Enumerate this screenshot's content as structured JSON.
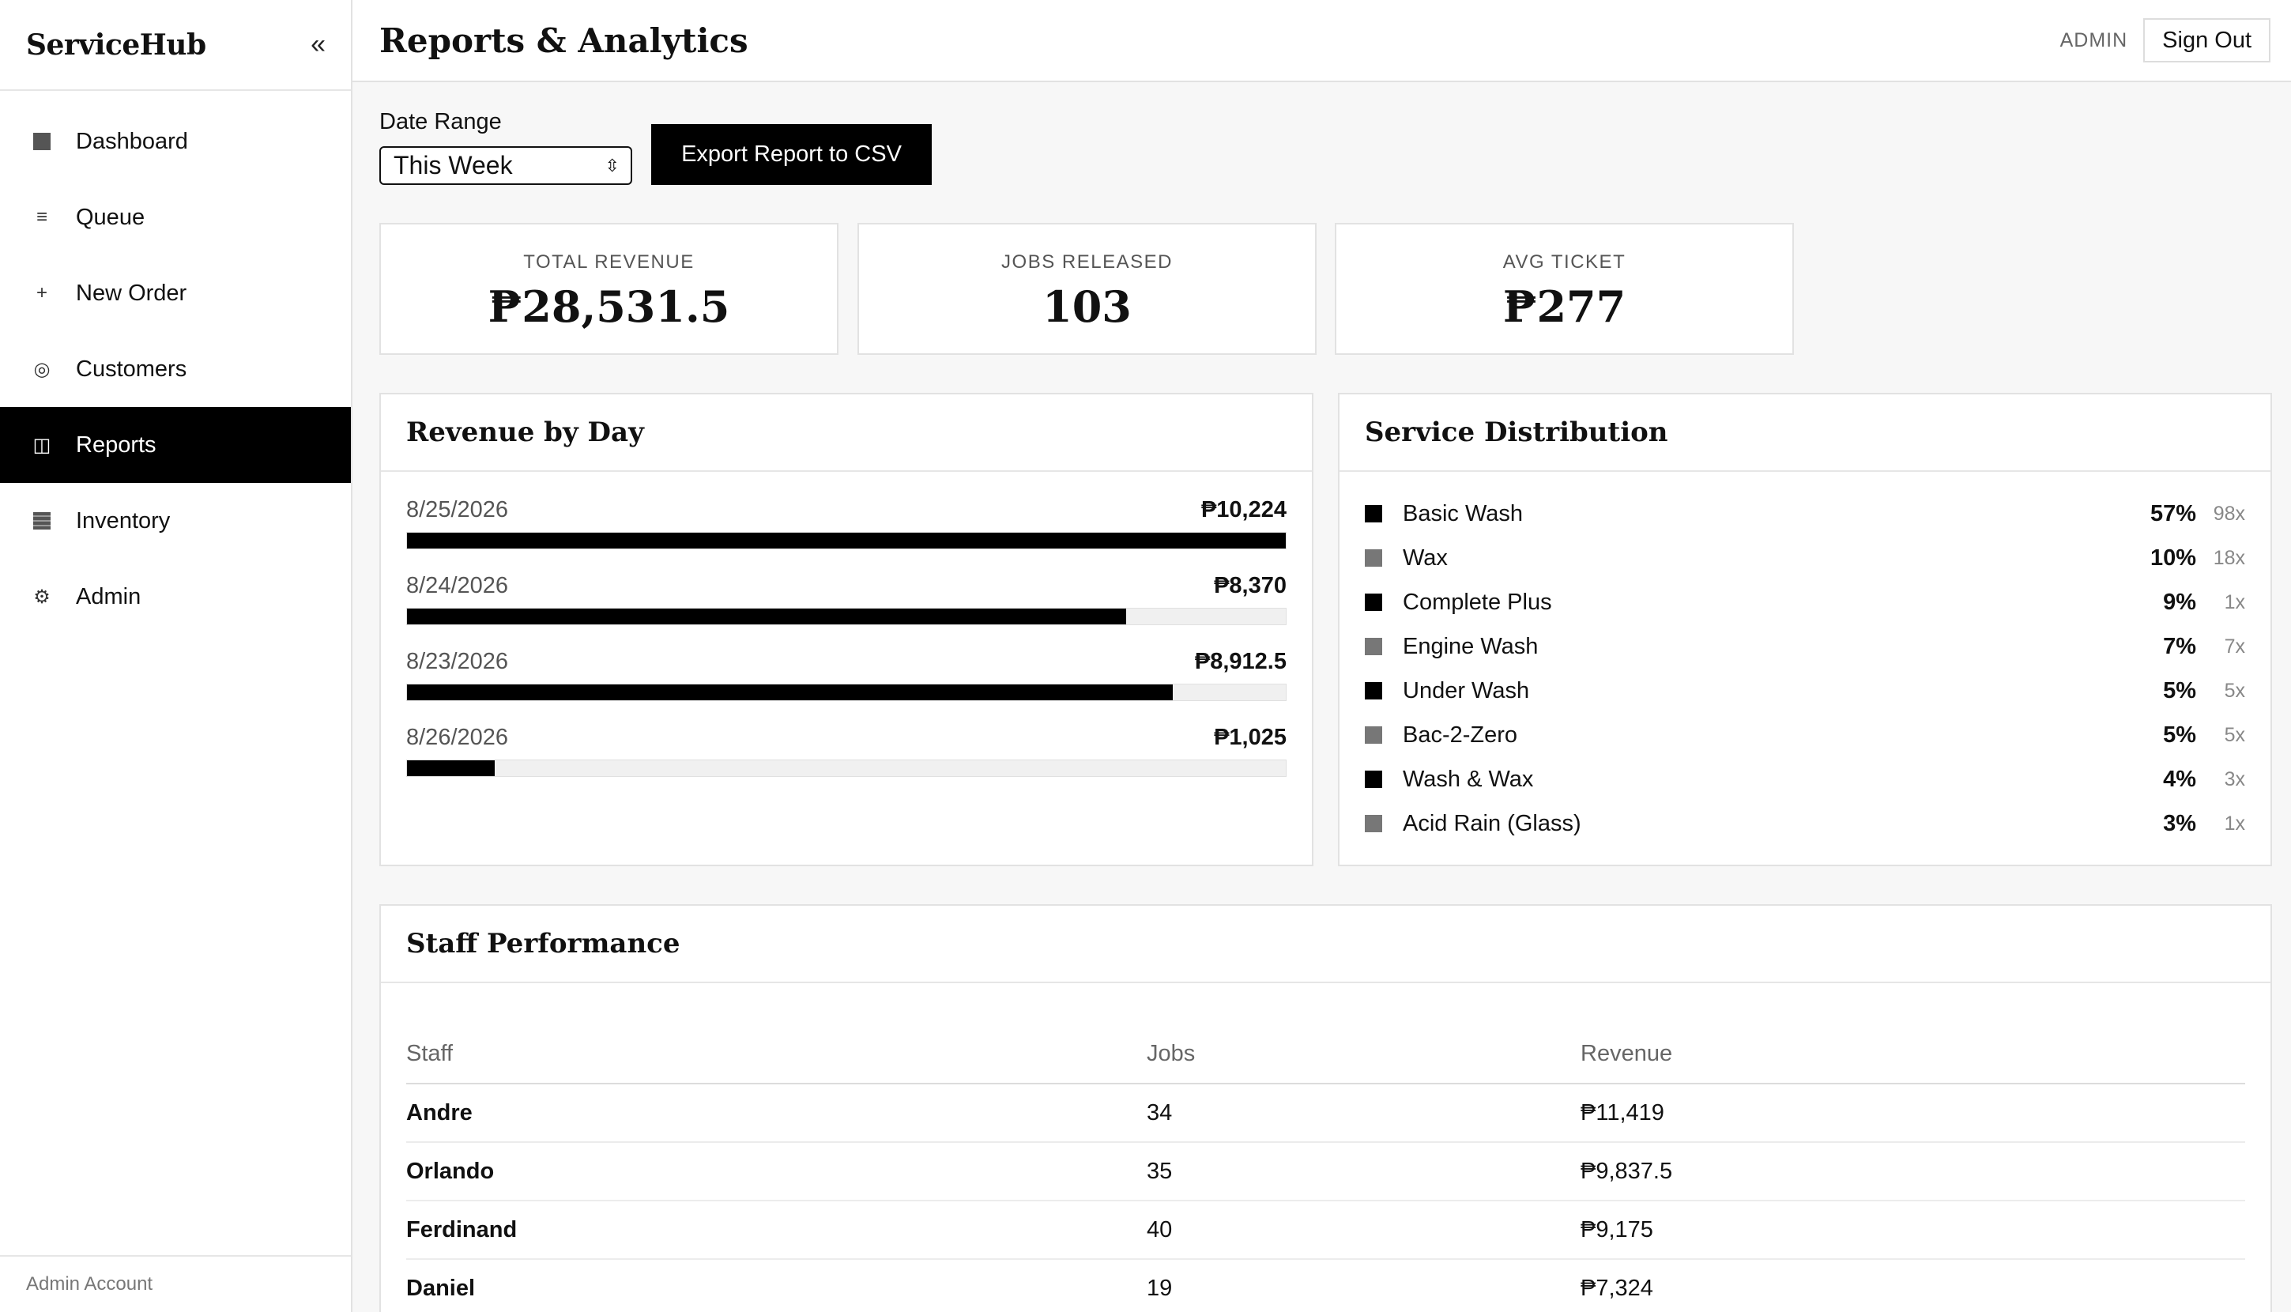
{
  "app": {
    "brand": "ServiceHub",
    "collapse_icon": "«",
    "footer": "Admin Account"
  },
  "nav": [
    {
      "label": "Dashboard",
      "icon": "dashboard-icon",
      "active": false
    },
    {
      "label": "Queue",
      "icon": "queue-icon",
      "active": false
    },
    {
      "label": "New Order",
      "icon": "plus-icon",
      "active": false
    },
    {
      "label": "Customers",
      "icon": "customers-icon",
      "active": false
    },
    {
      "label": "Reports",
      "icon": "reports-icon",
      "active": true
    },
    {
      "label": "Inventory",
      "icon": "inventory-icon",
      "active": false
    },
    {
      "label": "Admin",
      "icon": "gear-icon",
      "active": false
    }
  ],
  "header": {
    "title": "Reports & Analytics",
    "role": "ADMIN",
    "signout": "Sign Out"
  },
  "controls": {
    "date_range_label": "Date Range",
    "date_range_value": "This Week",
    "export_label": "Export Report to CSV"
  },
  "kpis": [
    {
      "label": "TOTAL REVENUE",
      "value": "₱28,531.5"
    },
    {
      "label": "JOBS RELEASED",
      "value": "103"
    },
    {
      "label": "AVG TICKET",
      "value": "₱277"
    }
  ],
  "revenue": {
    "title": "Revenue by Day",
    "rows": [
      {
        "date": "8/25/2026",
        "amount": "₱10,224",
        "value": 10224
      },
      {
        "date": "8/24/2026",
        "amount": "₱8,370",
        "value": 8370
      },
      {
        "date": "8/23/2026",
        "amount": "₱8,912.5",
        "value": 8912.5
      },
      {
        "date": "8/26/2026",
        "amount": "₱1,025",
        "value": 1025
      }
    ]
  },
  "services": {
    "title": "Service Distribution",
    "rows": [
      {
        "name": "Basic Wash",
        "pct": "57%",
        "count": "98x",
        "color": "#000000"
      },
      {
        "name": "Wax",
        "pct": "10%",
        "count": "18x",
        "color": "#777777"
      },
      {
        "name": "Complete Plus",
        "pct": "9%",
        "count": "1x",
        "color": "#000000"
      },
      {
        "name": "Engine Wash",
        "pct": "7%",
        "count": "7x",
        "color": "#777777"
      },
      {
        "name": "Under Wash",
        "pct": "5%",
        "count": "5x",
        "color": "#000000"
      },
      {
        "name": "Bac-2-Zero",
        "pct": "5%",
        "count": "5x",
        "color": "#777777"
      },
      {
        "name": "Wash & Wax",
        "pct": "4%",
        "count": "3x",
        "color": "#000000"
      },
      {
        "name": "Acid Rain (Glass)",
        "pct": "3%",
        "count": "1x",
        "color": "#777777"
      }
    ]
  },
  "staff": {
    "title": "Staff Performance",
    "columns": [
      "Staff",
      "Jobs",
      "Revenue"
    ],
    "rows": [
      {
        "name": "Andre",
        "jobs": "34",
        "revenue": "₱11,419"
      },
      {
        "name": "Orlando",
        "jobs": "35",
        "revenue": "₱9,837.5"
      },
      {
        "name": "Ferdinand",
        "jobs": "40",
        "revenue": "₱9,175"
      },
      {
        "name": "Daniel",
        "jobs": "19",
        "revenue": "₱7,324"
      }
    ]
  }
}
